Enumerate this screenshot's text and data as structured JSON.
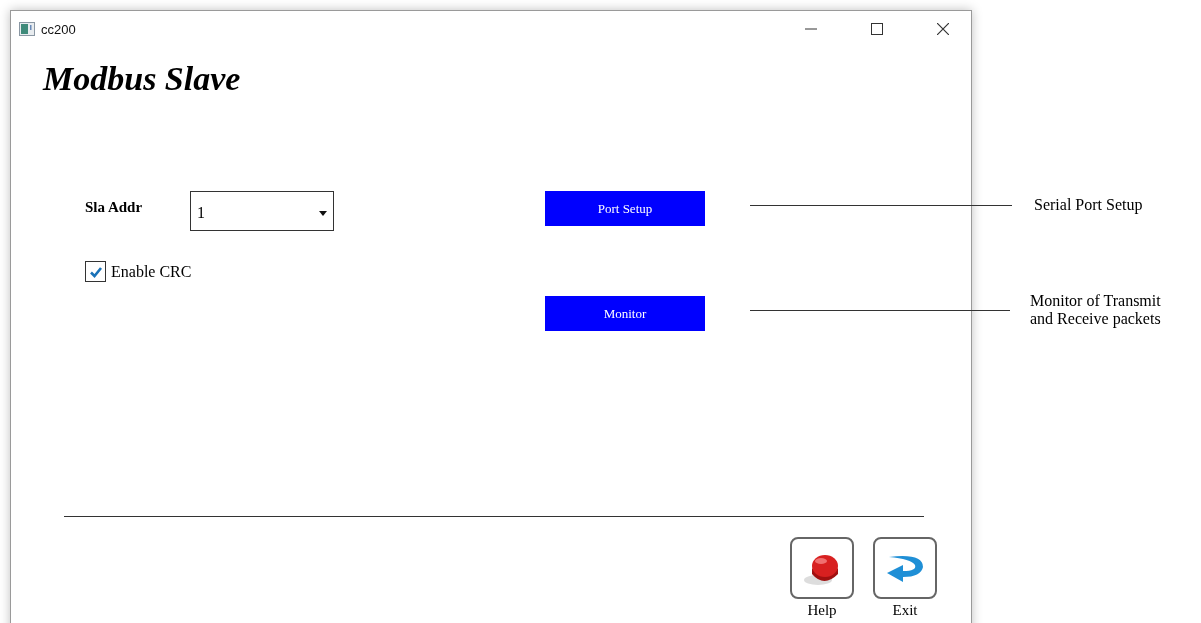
{
  "window": {
    "title": "cc200"
  },
  "heading": "Modbus Slave",
  "slave_address": {
    "label": "Sla Addr",
    "value": "1"
  },
  "enable_crc": {
    "label": "Enable CRC",
    "checked": true
  },
  "buttons": [
    {
      "label": "Port Setup",
      "callout": [
        "Serial Port Setup"
      ]
    },
    {
      "label": "Monitor",
      "callout": [
        "Monitor of Transmit",
        "and Receive packets"
      ]
    }
  ],
  "footer_buttons": [
    {
      "kind": "help",
      "label": "Help"
    },
    {
      "kind": "exit",
      "label": "Exit"
    }
  ]
}
